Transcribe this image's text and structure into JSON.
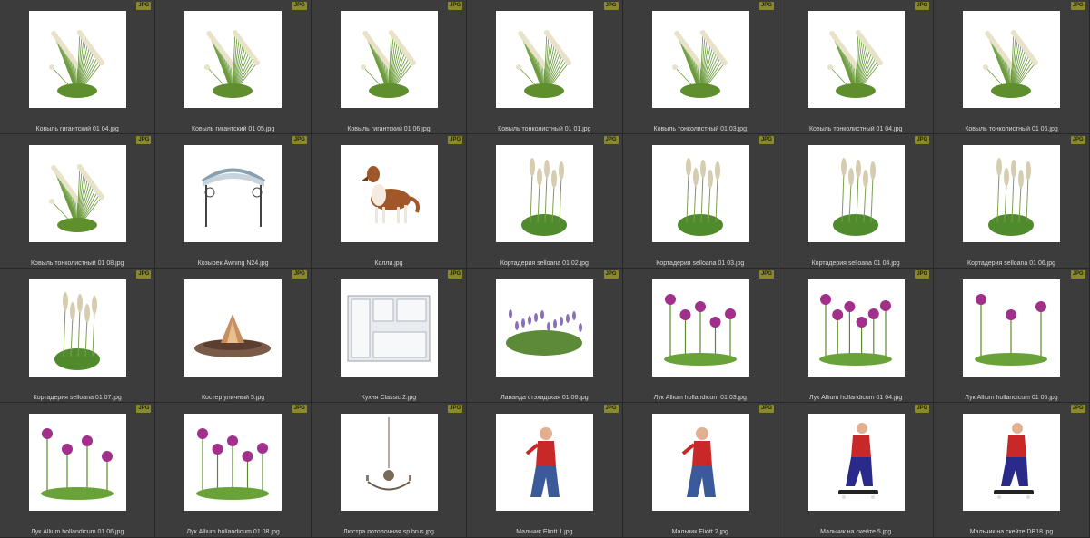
{
  "badge_label": "JPG",
  "files": [
    {
      "name": "Ковыль гигантский 01 04.jpg",
      "icon": "grass-icon"
    },
    {
      "name": "Ковыль гигантский 01 05.jpg",
      "icon": "grass-icon"
    },
    {
      "name": "Ковыль гигантский 01 06.jpg",
      "icon": "grass-icon"
    },
    {
      "name": "Ковыль тонколистный 01 01.jpg",
      "icon": "grass-icon"
    },
    {
      "name": "Ковыль тонколистный 01 03.jpg",
      "icon": "grass-icon"
    },
    {
      "name": "Ковыль тонколистный 01 04.jpg",
      "icon": "grass-icon"
    },
    {
      "name": "Ковыль тонколистный 01 06.jpg",
      "icon": "grass-icon"
    },
    {
      "name": "Ковыль тонколистный 01 08.jpg",
      "icon": "grass-icon"
    },
    {
      "name": "Козырек Awning N24.jpg",
      "icon": "awning-icon"
    },
    {
      "name": "Колли.jpg",
      "icon": "dog-icon"
    },
    {
      "name": "Кортадерия selloana 01 02.jpg",
      "icon": "pampas-icon"
    },
    {
      "name": "Кортадерия selloana 01 03.jpg",
      "icon": "pampas-icon"
    },
    {
      "name": "Кортадерия selloana 01 04.jpg",
      "icon": "pampas-icon"
    },
    {
      "name": "Кортадерия selloana 01 06.jpg",
      "icon": "pampas-icon"
    },
    {
      "name": "Кортадерия selloana 01 07.jpg",
      "icon": "pampas-icon"
    },
    {
      "name": "Костер уличный 5.jpg",
      "icon": "firepit-icon"
    },
    {
      "name": "Кухня Classic 2.jpg",
      "icon": "kitchen-icon"
    },
    {
      "name": "Лаванда стэхадская 01 06.jpg",
      "icon": "lavender-icon"
    },
    {
      "name": "Лук Allium hollandicum 01 03.jpg",
      "icon": "allium-icon"
    },
    {
      "name": "Лук Allium hollandicum 01 04.jpg",
      "icon": "allium-icon"
    },
    {
      "name": "Лук Allium hollandicum 01 05.jpg",
      "icon": "allium-icon"
    },
    {
      "name": "Лук Allium hollandicum 01 06.jpg",
      "icon": "allium-icon"
    },
    {
      "name": "Лук Allium hollandicum 01 08.jpg",
      "icon": "allium-icon"
    },
    {
      "name": "Люстра потолочная sp brus.jpg",
      "icon": "chandelier-icon"
    },
    {
      "name": "Мальчик Eliott 1.jpg",
      "icon": "boy-icon"
    },
    {
      "name": "Мальчик Eliott 2.jpg",
      "icon": "boy-icon"
    },
    {
      "name": "Мальчик на скейте 5.jpg",
      "icon": "skater-icon"
    },
    {
      "name": "Мальчик на скейте DB18.jpg",
      "icon": "skater-icon"
    }
  ]
}
